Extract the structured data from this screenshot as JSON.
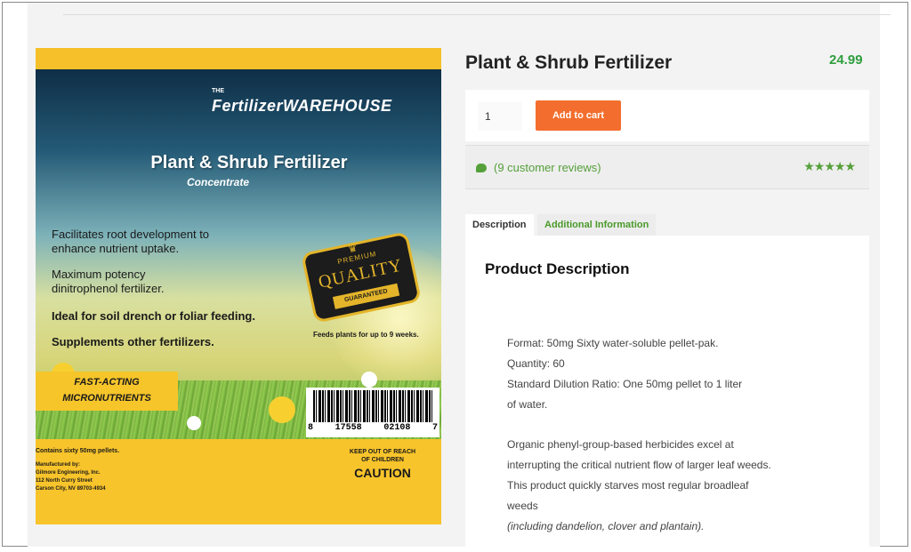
{
  "product": {
    "title": "Plant & Shrub Fertilizer",
    "price": "24.99",
    "quantity": "1",
    "add_to_cart_label": "Add to cart",
    "reviews_link": "(9 customer reviews)",
    "rating_stars": "★★★★★",
    "rating": 5
  },
  "tabs": [
    {
      "label": "Description",
      "active": true
    },
    {
      "label": "Additional Information",
      "active": false
    }
  ],
  "description": {
    "heading": "Product Description",
    "format": "Format: 50mg Sixty water-soluble pellet-pak.",
    "quantity": "Quantity: 60",
    "dilution_1": "Standard Dilution Ratio: One 50mg pellet to 1 liter",
    "dilution_2": "of water.",
    "body_1": "Organic phenyl-group-based herbicides excel at",
    "body_2": "interrupting the critical nutrient flow of larger leaf weeds.",
    "body_3": "This product quickly starves most regular broadleaf",
    "body_4": "weeds",
    "note": "(including dandelion, clover and plantain)."
  },
  "label": {
    "brand_small": "THE",
    "brand_name": "FertilizerWAREHOUSE",
    "title": "Plant & Shrub Fertilizer",
    "subtitle": "Concentrate",
    "claim_1a": "Facilitates root development to",
    "claim_1b": "enhance nutrient uptake.",
    "claim_2a": "Maximum potency",
    "claim_2b": "dinitrophenol fertilizer.",
    "claim_3": "Ideal for soil drench or foliar feeding.",
    "claim_4": "Supplements other fertilizers.",
    "badge_premium": "PREMIUM",
    "badge_quality": "QUALITY",
    "badge_guaranteed": "GUARANTEED",
    "feeds": "Feeds plants for up to 9 weeks.",
    "fast_1": "FAST-ACTING",
    "fast_2": "MICRONUTRIENTS",
    "barcode_1": "8",
    "barcode_2": "17558",
    "barcode_3": "02108",
    "barcode_4": "7",
    "contains": "Contains sixty 50mg pellets.",
    "mfg_1": "Manufactured by:",
    "mfg_2": "Gilmore Engineering, Inc.",
    "mfg_3": "112 North Curry Street",
    "mfg_4": "Carson City, NV 89703-4934",
    "keep_1": "KEEP OUT OF REACH",
    "keep_2": "OF CHILDREN",
    "caution": "CAUTION"
  },
  "colors": {
    "price": "#2e9e3e",
    "add_to_cart": "#f36e2e",
    "review_green": "#55a03a",
    "label_yellow": "#f8c42b"
  }
}
